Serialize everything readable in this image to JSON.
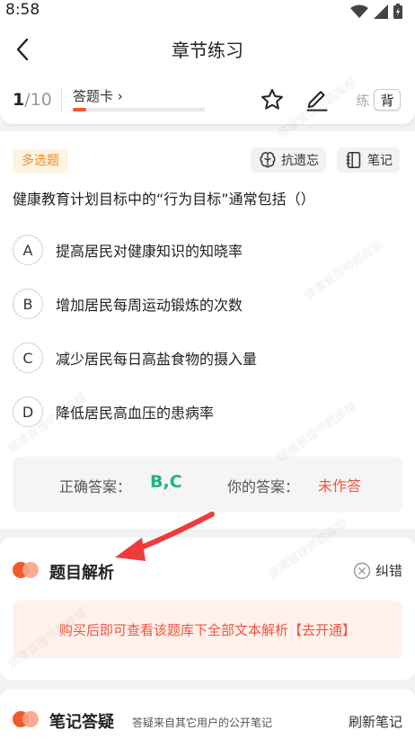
{
  "status": {
    "time": "8:58"
  },
  "header": {
    "title": "章节练习"
  },
  "toolbar": {
    "progress_current": "1",
    "progress_total": "/10",
    "answer_card_label": "答题卡 ›",
    "progress_fraction": 0.1,
    "mode_practice": "练",
    "mode_memorize": "背"
  },
  "question": {
    "type_tag": "多选题",
    "anti_forget_label": "抗遗忘",
    "notes_label": "笔记",
    "text": "健康教育计划目标中的“行为目标”通常包括（）",
    "options": [
      {
        "letter": "A",
        "text": "提高居民对健康知识的知晓率"
      },
      {
        "letter": "B",
        "text": "增加居民每周运动锻炼的次数"
      },
      {
        "letter": "C",
        "text": "减少居民每日高盐食物的摄入量"
      },
      {
        "letter": "D",
        "text": "降低居民高血压的患病率"
      }
    ],
    "correct_label": "正确答案：",
    "correct_value": "B,C",
    "user_label": "你的答案：",
    "user_value": "未作答"
  },
  "analysis": {
    "title": "题目解析",
    "report_label": "纠错",
    "unlock_text": "购买后即可查看该题库下全部文本解析【去开通】"
  },
  "notes_section": {
    "title": "笔记答疑",
    "subtitle": "答疑来自其它用户的公开笔记",
    "refresh_label": "刷新笔记"
  },
  "watermark_text": "健康管理师题库帮",
  "colors": {
    "accent": "#f05a28",
    "correct": "#1db28a",
    "wrong": "#f0553f",
    "tag_bg": "#fff4e0",
    "tag_text": "#f08c1e"
  }
}
